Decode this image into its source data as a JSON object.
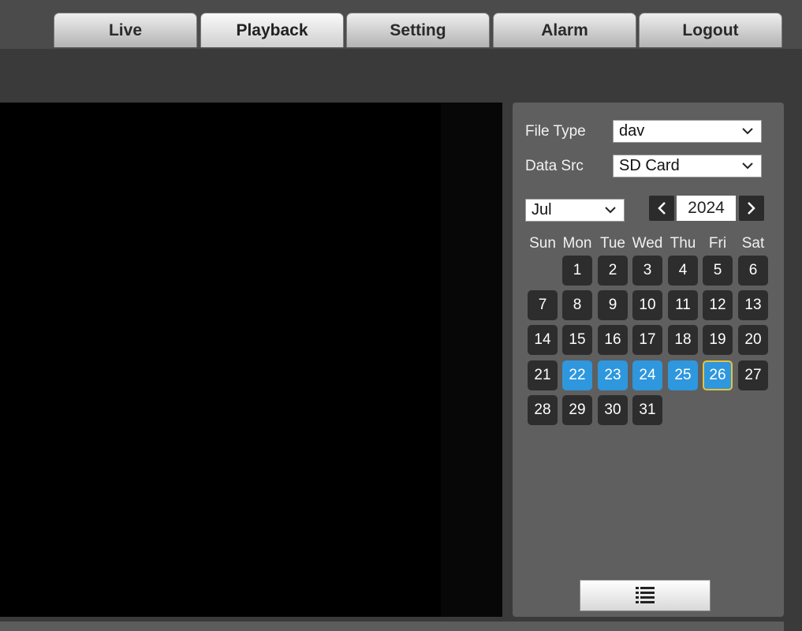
{
  "nav": {
    "tabs": [
      {
        "label": "Live"
      },
      {
        "label": "Playback",
        "active": true
      },
      {
        "label": "Setting"
      },
      {
        "label": "Alarm"
      },
      {
        "label": "Logout"
      }
    ]
  },
  "panel": {
    "file_type": {
      "label": "File Type",
      "value": "dav"
    },
    "data_src": {
      "label": "Data Src",
      "value": "SD Card"
    },
    "month": "Jul",
    "year": "2024",
    "prev_icon": "chevron-left-icon",
    "next_icon": "chevron-right-icon",
    "list_icon": "list-icon"
  },
  "calendar": {
    "weekdays": [
      "Sun",
      "Mon",
      "Tue",
      "Wed",
      "Thu",
      "Fri",
      "Sat"
    ],
    "weeks": [
      [
        "",
        "1",
        "2",
        "3",
        "4",
        "5",
        "6"
      ],
      [
        "7",
        "8",
        "9",
        "10",
        "11",
        "12",
        "13"
      ],
      [
        "14",
        "15",
        "16",
        "17",
        "18",
        "19",
        "20"
      ],
      [
        "21",
        "22",
        "23",
        "24",
        "25",
        "26",
        "27"
      ],
      [
        "28",
        "29",
        "30",
        "31",
        "",
        "",
        ""
      ]
    ],
    "record_days": [
      "22",
      "23",
      "24",
      "25",
      "26"
    ],
    "selected_day": "26",
    "colors": {
      "record": "#2e97dd",
      "selected_border": "#e8c23a",
      "day": "#2d2d2d"
    }
  }
}
